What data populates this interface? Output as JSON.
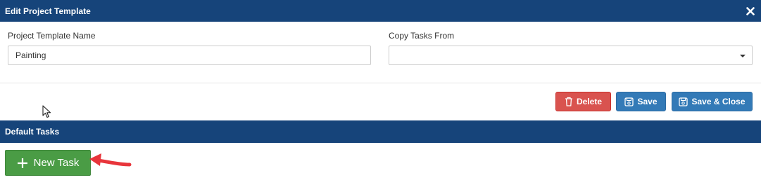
{
  "dialog": {
    "title": "Edit Project Template",
    "close_icon": "close-icon"
  },
  "form": {
    "template_name_label": "Project Template Name",
    "template_name_value": "Painting",
    "copy_tasks_label": "Copy Tasks From",
    "copy_tasks_value": ""
  },
  "actions": {
    "delete_label": "Delete",
    "save_label": "Save",
    "save_close_label": "Save & Close"
  },
  "default_tasks": {
    "section_title": "Default Tasks",
    "new_task_label": "New Task"
  },
  "colors": {
    "header_bg": "#16447a",
    "danger": "#d9534f",
    "primary": "#337ab7",
    "success": "#4a9c45",
    "annotation_arrow": "#e8353b"
  },
  "icons": [
    "close-icon",
    "trash-icon",
    "save-icon",
    "plus-icon",
    "mouse-pointer-icon",
    "annotation-arrow-icon"
  ]
}
